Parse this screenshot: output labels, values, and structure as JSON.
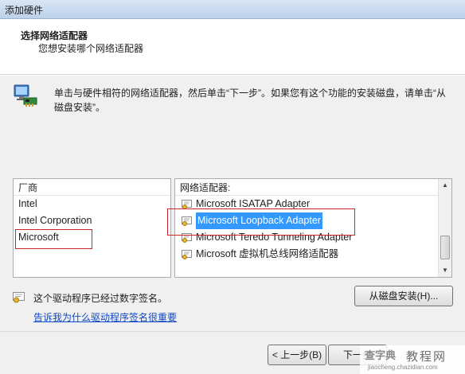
{
  "window": {
    "title": "添加硬件"
  },
  "header": {
    "title": "选择网络适配器",
    "subtitle": "您想安装哪个网络适配器"
  },
  "instruction": "单击与硬件相符的网络适配器，然后单击“下一步”。如果您有这个功能的安装磁盘，请单击“从磁盘安装”。",
  "vendors": {
    "header": "厂商",
    "items": [
      "Intel",
      "Intel Corporation",
      "Microsoft"
    ],
    "selected": "Microsoft"
  },
  "adapters": {
    "header": "网络适配器:",
    "items": [
      "Microsoft ISATAP Adapter",
      "Microsoft Loopback Adapter",
      "Microsoft Teredo Tunneling Adapter",
      "Microsoft 虚拟机总线网络适配器"
    ],
    "selected": "Microsoft Loopback Adapter"
  },
  "signature": {
    "text": "这个驱动程序已经过数字签名。",
    "link": "告诉我为什么驱动程序签名很重要"
  },
  "buttons": {
    "have_disk": "从磁盘安装(H)...",
    "back": "< 上一步(B)",
    "next": "下一步"
  },
  "watermark": {
    "logo": "查字典",
    "name": "教程网",
    "url": "jiaocheng.chazidian.com"
  },
  "colors": {
    "selection": "#3399ff",
    "highlight_box": "#c8262b",
    "link": "#0f49c4"
  },
  "icons": {
    "network_adapter": "network-adapter-icon",
    "certificate": "certificate-icon"
  }
}
